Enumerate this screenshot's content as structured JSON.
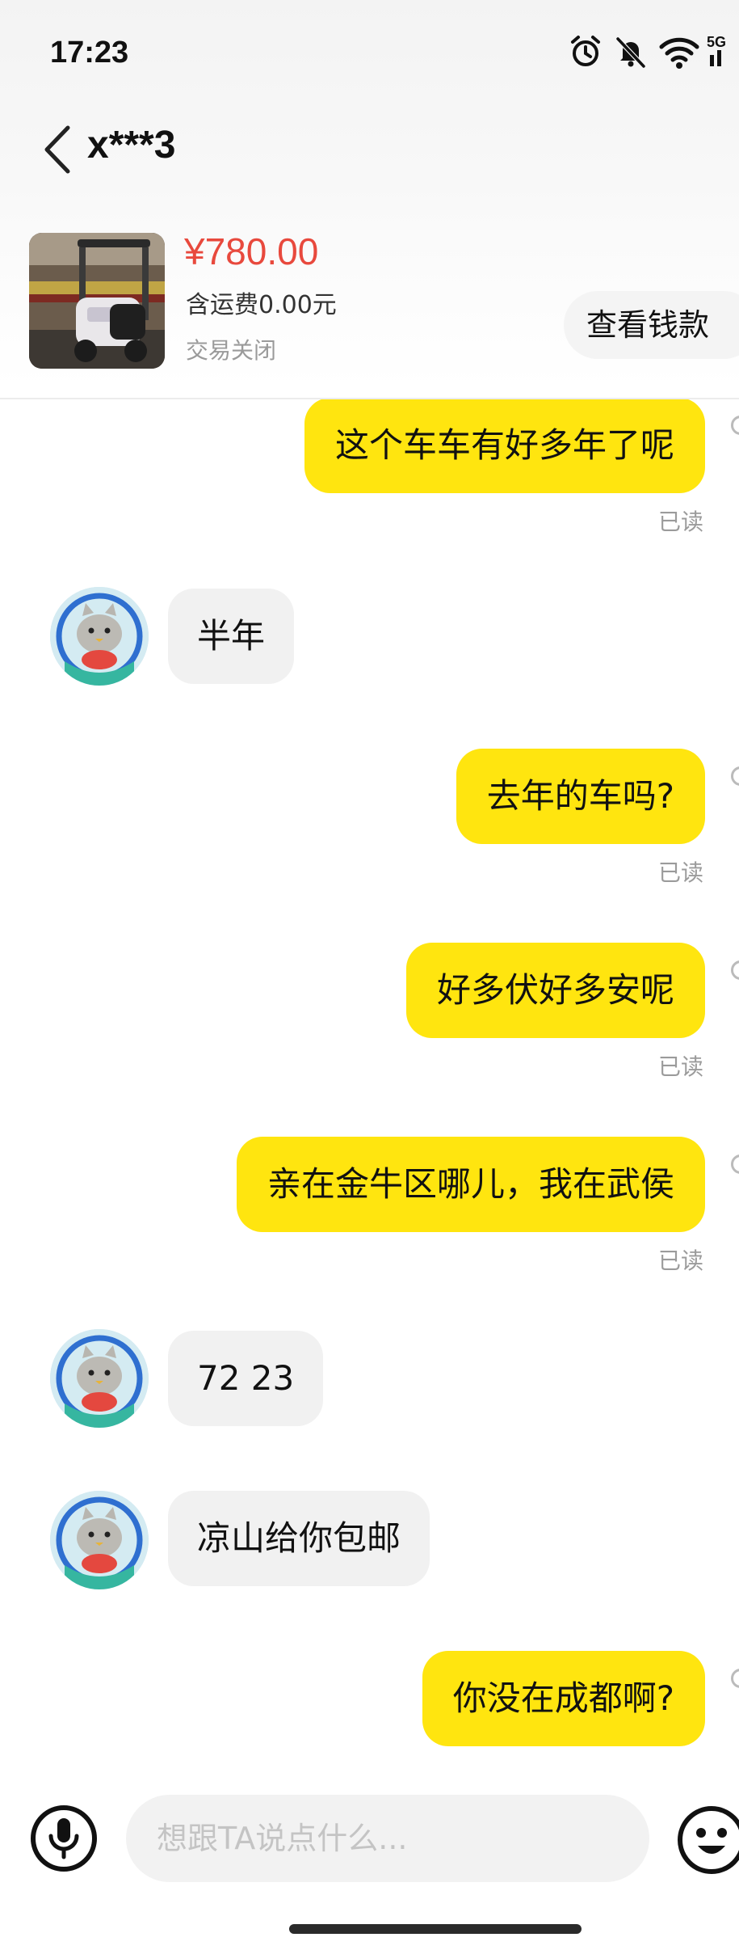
{
  "status_bar": {
    "time": "17:23",
    "network": "5G",
    "icons": [
      "alarm-icon",
      "mute-icon",
      "wifi-icon",
      "signal-icon"
    ]
  },
  "header": {
    "back_icon": "chevron-left-icon",
    "title": "x***3"
  },
  "product": {
    "price": "¥780.00",
    "shipping": "含运费0.00元",
    "status": "交易关闭",
    "view_money_label": "查看钱款"
  },
  "messages": [
    {
      "side": "out",
      "text": "这个车车有好多年了呢",
      "read_label": "已读"
    },
    {
      "side": "in",
      "text": "半年"
    },
    {
      "side": "out",
      "text": "去年的车吗?",
      "read_label": "已读"
    },
    {
      "side": "out",
      "text": "好多伏好多安呢",
      "read_label": "已读"
    },
    {
      "side": "out",
      "text": "亲在金牛区哪儿，我在武侯",
      "read_label": "已读"
    },
    {
      "side": "in",
      "text": "72 23"
    },
    {
      "side": "in",
      "text": "凉山给你包邮"
    },
    {
      "side": "out",
      "text": "你没在成都啊?"
    }
  ],
  "input_bar": {
    "voice_icon": "microphone-icon",
    "placeholder": "想跟TA说点什么...",
    "emoji_icon": "emoji-icon"
  },
  "colors": {
    "price": "#e8493d",
    "outgoing_bubble": "#ffe50f",
    "incoming_bubble": "#f1f1f1",
    "read_label": "#9b9b9b"
  }
}
